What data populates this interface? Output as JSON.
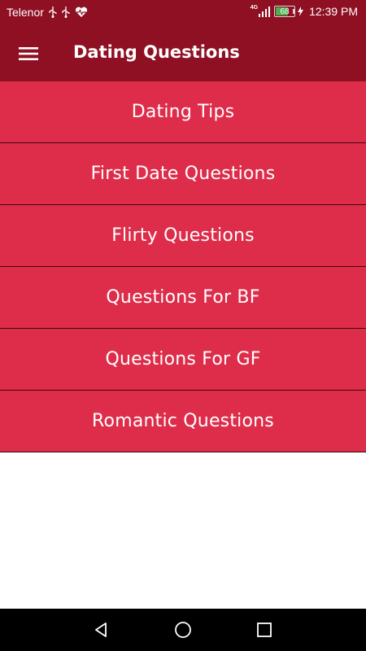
{
  "status_bar": {
    "carrier": "Telenor",
    "network_badge": "4G",
    "battery_level": "68",
    "time": "12:39 PM",
    "icons": [
      "usb-icon",
      "usb-icon",
      "heart-rate-icon",
      "signal-icon",
      "battery-icon",
      "charging-icon"
    ]
  },
  "app_bar": {
    "title": "Dating Questions",
    "menu_icon": "hamburger-menu-icon"
  },
  "menu": {
    "items": [
      {
        "label": "Dating Tips"
      },
      {
        "label": "First Date Questions"
      },
      {
        "label": "Flirty Questions"
      },
      {
        "label": "Questions For BF"
      },
      {
        "label": "Questions For GF"
      },
      {
        "label": "Romantic Questions"
      }
    ]
  },
  "nav_bar": {
    "icons": [
      "back-icon",
      "home-icon",
      "recents-icon"
    ]
  },
  "colors": {
    "primary_dark": "#8e1022",
    "item_background": "#de2d4a",
    "divider": "#3a0a12",
    "nav_bar": "#000000",
    "battery_fill": "#4caf50"
  }
}
